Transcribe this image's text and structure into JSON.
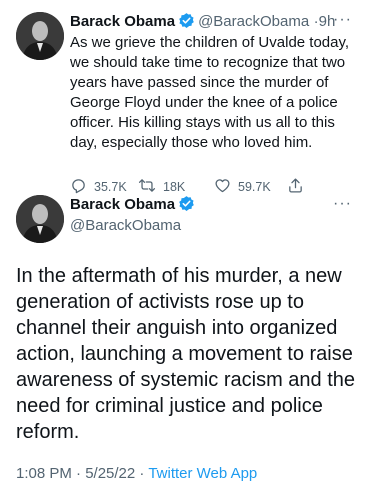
{
  "tweet1": {
    "author_name": "Barack Obama",
    "handle": "@BarackObama",
    "separator": "·",
    "time": "9h",
    "text": "As we grieve the children of Uvalde today, we should take time to recognize that two years have passed since the murder of George Floyd under the knee of a police officer. His killing stays with us all to this day, especially those who loved him.",
    "replies": "35.7K",
    "retweets": "18K",
    "likes": "59.7K"
  },
  "tweet2": {
    "author_name": "Barack Obama",
    "handle": "@BarackObama",
    "text": "In the aftermath of his murder, a new generation of activists rose up to channel their anguish into organized action, launching a movement to raise awareness of systemic racism and the need for criminal justice and police reform.",
    "time": "1:08 PM · 5/25/22",
    "separator": " · ",
    "source": "Twitter Web App"
  },
  "more_label": "···",
  "colors": {
    "accent": "#1d9bf0",
    "text": "#0f1419",
    "muted": "#536471"
  },
  "icons": [
    "verified-badge-icon",
    "more-icon",
    "reply-icon",
    "retweet-icon",
    "like-icon",
    "share-icon"
  ]
}
